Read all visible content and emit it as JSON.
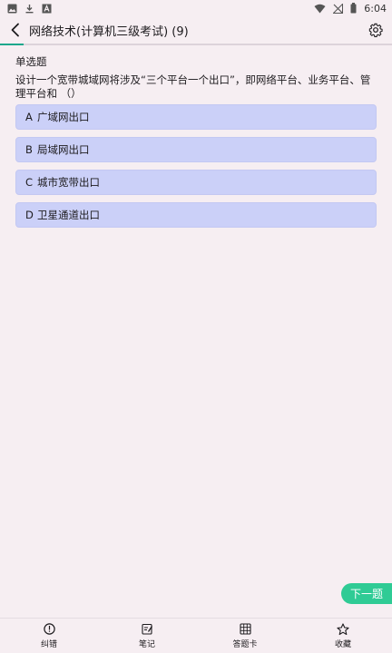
{
  "status_bar": {
    "time": "6:04",
    "left_icons": [
      "image-icon",
      "download-icon",
      "app-a-icon"
    ],
    "right_icons": [
      "wifi-icon",
      "signal-off-icon",
      "battery-icon"
    ]
  },
  "app_bar": {
    "title": "网络技术(计算机三级考试) (9)"
  },
  "progress": {
    "fraction": 0.06,
    "color": "#1aa78b"
  },
  "question": {
    "type": "单选题",
    "stem": "设计一个宽带城域网将涉及“三个平台一个出口”，即网络平台、业务平台、管理平台和 （）",
    "options": [
      {
        "letter": "A",
        "text": "广域网出口"
      },
      {
        "letter": "B",
        "text": "局域网出口"
      },
      {
        "letter": "C",
        "text": "城市宽带出口"
      },
      {
        "letter": "D",
        "text": "卫星通道出口"
      }
    ]
  },
  "next_button": {
    "label": "下一题"
  },
  "bottom_nav": [
    {
      "label": "纠错",
      "icon": "alert-circle-icon"
    },
    {
      "label": "笔记",
      "icon": "note-edit-icon"
    },
    {
      "label": "答题卡",
      "icon": "grid-card-icon"
    },
    {
      "label": "收藏",
      "icon": "star-icon"
    }
  ],
  "colors": {
    "background": "#f6eef2",
    "option_bg": "#cbd0f8",
    "accent_green": "#2fcb95"
  }
}
